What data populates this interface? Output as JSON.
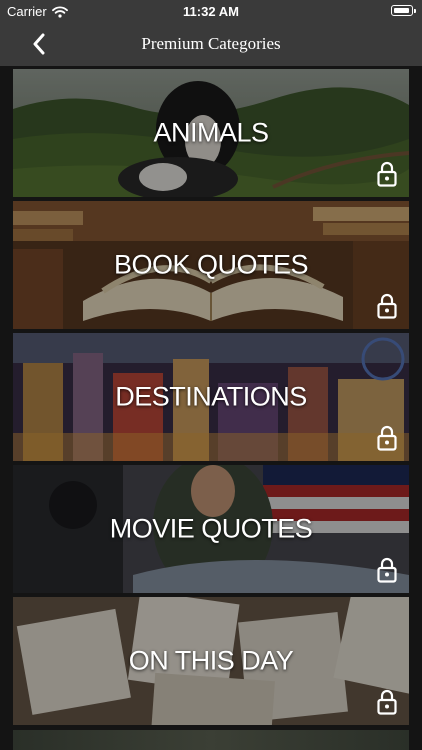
{
  "status_bar": {
    "carrier": "Carrier",
    "time": "11:32 AM"
  },
  "nav": {
    "title": "Premium Categories"
  },
  "categories": [
    {
      "title": "ANIMALS",
      "locked": true
    },
    {
      "title": "BOOK QUOTES",
      "locked": true
    },
    {
      "title": "DESTINATIONS",
      "locked": true
    },
    {
      "title": "MOVIE QUOTES",
      "locked": true
    },
    {
      "title": "ON THIS DAY",
      "locked": true
    }
  ],
  "colors": {
    "bar_background": "#3a3a3a",
    "list_background": "#141414",
    "text": "#ffffff"
  }
}
